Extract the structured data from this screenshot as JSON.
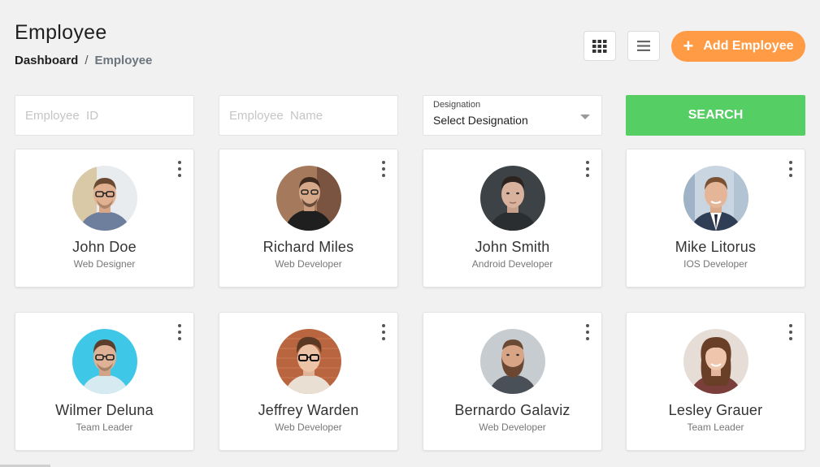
{
  "header": {
    "title": "Employee",
    "breadcrumb": {
      "home": "Dashboard",
      "separator": "/",
      "current": "Employee"
    },
    "grid_view_icon": "grid-icon",
    "list_view_icon": "list-icon",
    "add_button": {
      "icon": "plus-icon",
      "label": "Add  Employee"
    }
  },
  "filters": {
    "employee_id": {
      "placeholder": "Employee  ID",
      "value": ""
    },
    "employee_name": {
      "placeholder": "Employee  Name",
      "value": ""
    },
    "designation": {
      "label": "Designation",
      "value": "Select  Designation"
    },
    "search_label": "SEARCH"
  },
  "employees": [
    {
      "name": "John  Doe",
      "role": "Web  Designer"
    },
    {
      "name": "Richard  Miles",
      "role": "Web  Developer"
    },
    {
      "name": "John  Smith",
      "role": "Android  Developer"
    },
    {
      "name": "Mike  Litorus",
      "role": "IOS  Developer"
    },
    {
      "name": "Wilmer  Deluna",
      "role": "Team  Leader"
    },
    {
      "name": "Jeffrey  Warden",
      "role": "Web  Developer"
    },
    {
      "name": "Bernardo  Galaviz",
      "role": "Web  Developer"
    },
    {
      "name": "Lesley  Grauer",
      "role": "Team  Leader"
    }
  ],
  "colors": {
    "accent": "#ff9b44",
    "search": "#55ce63",
    "background": "#f1f1f1"
  }
}
